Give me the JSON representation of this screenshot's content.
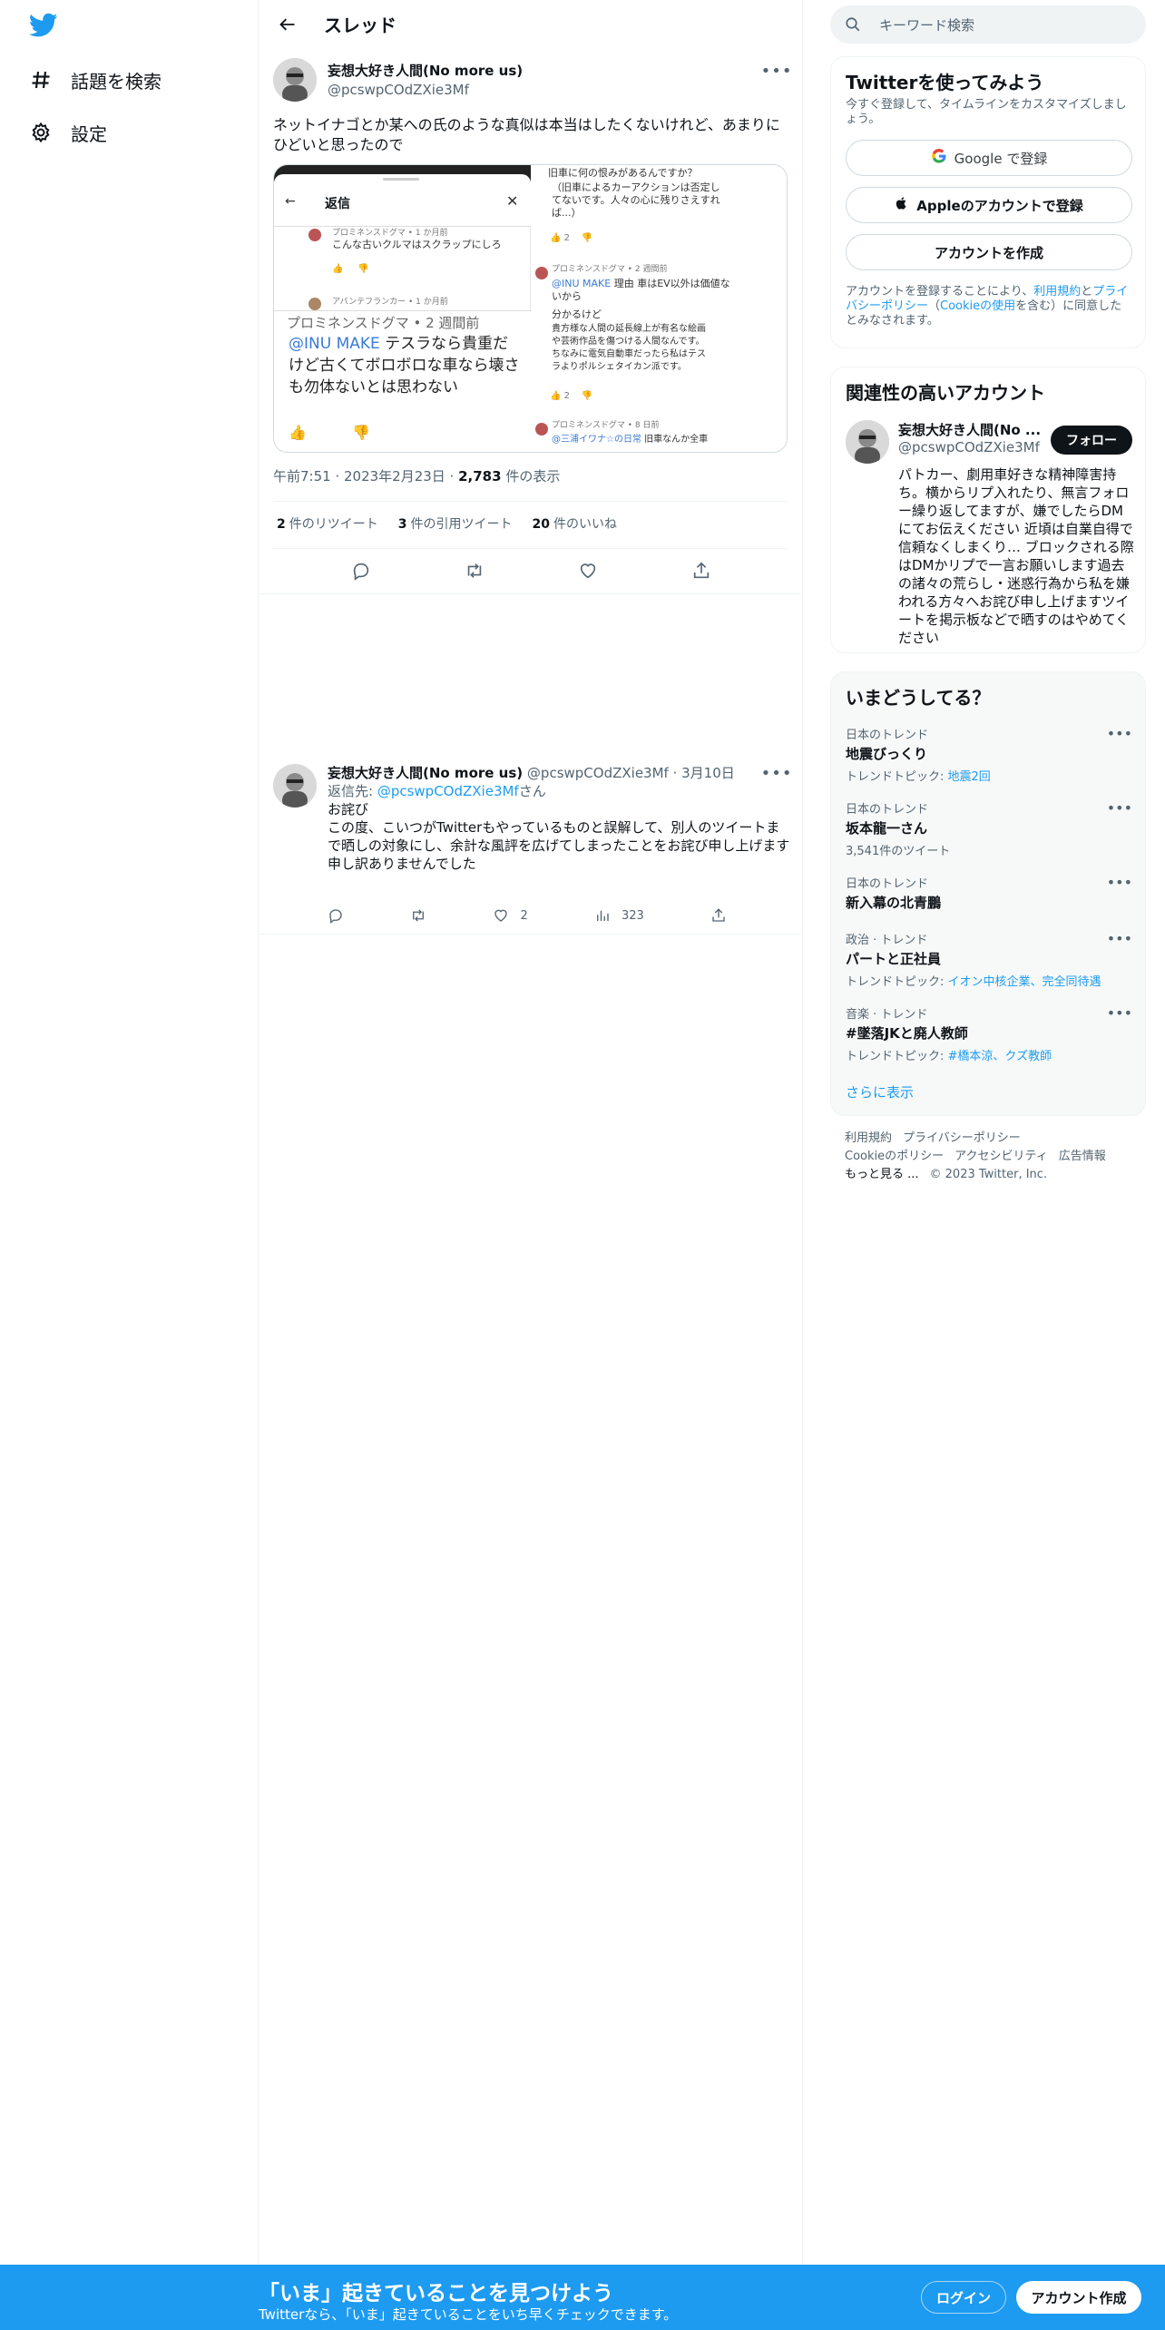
{
  "nav": {
    "explore": "話題を検索",
    "settings": "設定"
  },
  "header": {
    "title": "スレッド"
  },
  "tweet": {
    "name": "妄想大好き人間(No more us)",
    "handle": "@pcswpCOdZXie3Mf",
    "text": "ネットイナゴとか某への氏のような真似は本当はしたくないけれど、あまりにひどいと思ったので",
    "time": "午前7:51 · 2023年2月23日 · ",
    "views_count": "2,783",
    "views_label": " 件の表示",
    "retweets_count": "2",
    "retweets_label": "件のリツイート",
    "quotes_count": "3",
    "quotes_label": "件の引用ツイート",
    "likes_count": "20",
    "likes_label": "件のいいね",
    "media": {
      "left": {
        "header": "返信",
        "c1_meta": "プロミネンスドグマ • 1 か月前",
        "c1_text": "こんな古いクルマはスクラップにしろ",
        "c2_meta": "アバンテフランカー • 1 か月前",
        "big_meta": "プロミネンスドグマ • 2 週間前",
        "big_mention": "@INU MAKE",
        "big_text1": " テスラなら貴重だ",
        "big_text2": "けど古くてボロボロな車なら壊さ",
        "big_text3": "も勿体ないとは思わない"
      },
      "right": {
        "r1": "旧車に何の恨みがあるんですか？",
        "r2": "（旧車によるカーアクションは否定し",
        "r3": "てないです。人々の心に残りさえすれ",
        "r4": "ば...）",
        "r_like": "2",
        "r_meta": "プロミネンスドグマ • 2 週間前",
        "r_mention": "@INU MAKE",
        "r_text1": " 理由 車はEV以外は価値な",
        "r_text2": "いから",
        "r_text3": "分かるけど",
        "r_text4": "貴方様な人間の延長線上が有名な絵画",
        "r_text5": "や芸術作品を傷つける人間なんです。",
        "r_text6": "ちなみに電気自動車だったら私はテス",
        "r_text7": "ラよりポルシェタイカン派です。",
        "r_like2": "2",
        "r_meta2": "プロミネンスドグマ • 8 日前",
        "r_mention2": "@三浦イワナ☆の日常",
        "r_text8": " 旧車なんか全車"
      }
    }
  },
  "reply": {
    "name": "妄想大好き人間(No more us)",
    "handle": "@pcswpCOdZXie3Mf",
    "date": "· 3月10日",
    "reply_to_prefix": "返信先: ",
    "reply_to_handle": "@pcswpCOdZXie3Mf",
    "reply_to_suffix": "さん",
    "line1": "お詫び",
    "line2": "この度、こいつがTwitterもやっているものと誤解して、別人のツイートまで晒しの対象にし、余計な風評を広げてしまったことをお詫び申し上げます",
    "line3": "申し訳ありませんでした",
    "likes": "2",
    "views": "323"
  },
  "search": {
    "placeholder": "キーワード検索"
  },
  "signup_card": {
    "title": "Twitterを使ってみよう",
    "subtitle": "今すぐ登録して、タイムラインをカスタマイズしましょう。",
    "google": "Google で登録",
    "apple": "Appleのアカウントで登録",
    "create": "アカウントを作成",
    "terms_prefix": "アカウントを登録することにより、",
    "terms_link": "利用規約",
    "terms_and": "と",
    "privacy_link": "プライバシーポリシー",
    "cookie_open": "（",
    "cookie_link": "Cookieの使用",
    "terms_suffix": "を含む）に同意したとみなされます。"
  },
  "related": {
    "title": "関連性の高いアカウント",
    "name": "妄想大好き人間(No ...",
    "handle": "@pcswpCOdZXie3Mf",
    "follow": "フォロー",
    "bio": "パトカー、劇用車好きな精神障害持ち。横からリプ入れたり、無言フォロー繰り返してますが、嫌でしたらDMにてお伝えください 近頃は自業自得で信頼なくしまくり… ブロックされる際はDMかリプで一言お願いします過去の諸々の荒らし・迷惑行為から私を嫌われる方々へお詫び申し上げますツイートを掲示板などで晒すのはやめてください"
  },
  "trends": {
    "title": "いまどうしてる？",
    "items": [
      {
        "cat": "日本のトレンド",
        "name": "地震びっくり",
        "sub_prefix": "トレンドトピック: ",
        "sub_link": "地震2回",
        "sub_text": ""
      },
      {
        "cat": "日本のトレンド",
        "name": "坂本龍一さん",
        "sub_prefix": "",
        "sub_link": "",
        "sub_text": "3,541件のツイート"
      },
      {
        "cat": "日本のトレンド",
        "name": "新入幕の北青鵬",
        "sub_prefix": "",
        "sub_link": "",
        "sub_text": ""
      },
      {
        "cat": "政治 · トレンド",
        "name": "パートと正社員",
        "sub_prefix": "トレンドトピック: ",
        "sub_link": "イオン中核企業、完全同待遇",
        "sub_text": ""
      },
      {
        "cat": "音楽 · トレンド",
        "name": "#墜落JKと廃人教師",
        "sub_prefix": "トレンドトピック: ",
        "sub_link": "#橋本涼、クズ教師",
        "sub_text": ""
      }
    ],
    "more": "さらに表示"
  },
  "footer": {
    "terms": "利用規約",
    "privacy": "プライバシーポリシー",
    "cookie": "Cookieのポリシー",
    "accessibility": "アクセシビリティ",
    "ads": "広告情報",
    "more": "もっと見る ...",
    "copyright": "© 2023 Twitter, Inc."
  },
  "bottombar": {
    "title": "「いま」起きていることを見つけよう",
    "subtitle": "Twitterなら、「いま」起きていることをいち早くチェックできます。",
    "login": "ログイン",
    "signup": "アカウント作成"
  },
  "colors": {
    "accent": "#1d9bf0",
    "text": "#0f1419",
    "muted": "#536471"
  }
}
